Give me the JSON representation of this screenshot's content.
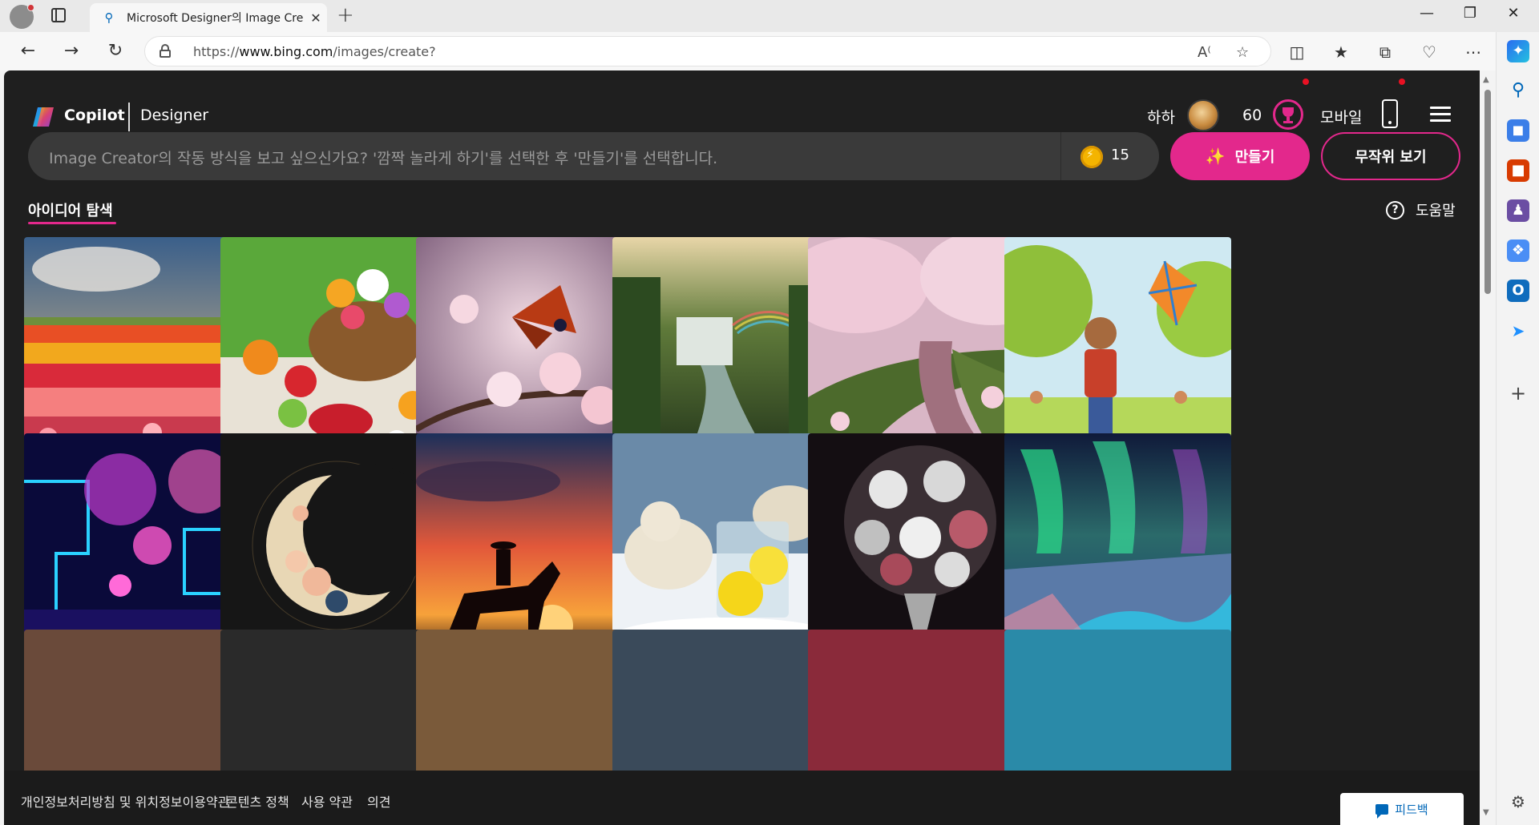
{
  "browser": {
    "tab_title": "Microsoft Designer의 Image Crea",
    "url_scheme": "https://",
    "url_host": "www.bing.com",
    "url_path": "/images/create?"
  },
  "header": {
    "brand": "Copilot",
    "product": "Designer",
    "user_name": "하하",
    "points": "60",
    "mobile_label": "모바일"
  },
  "prompt": {
    "placeholder": "Image Creator의 작동 방식을 보고 싶으신가요? '깜짝 놀라게 하기'를 선택한 후 '만들기'를 선택합니다.",
    "boost_count": "15",
    "create_label": "만들기",
    "surprise_label": "무작위 보기"
  },
  "explore": {
    "tab_label": "아이디어 탐색",
    "help_label": "도움말"
  },
  "gallery": [
    {
      "subject": "tulip-field"
    },
    {
      "subject": "picnic-flower-basket"
    },
    {
      "subject": "butterfly-cherry-blossom"
    },
    {
      "subject": "jungle-waterfall-rainbow"
    },
    {
      "subject": "cherry-blossom-river"
    },
    {
      "subject": "boy-flying-kite"
    },
    {
      "subject": "neon-circuit-garden"
    },
    {
      "subject": "floral-crescent-moon"
    },
    {
      "subject": "cowboy-sunset"
    },
    {
      "subject": "polar-bears-lemonade"
    },
    {
      "subject": "white-flower-bouquet"
    },
    {
      "subject": "aurora-landscape"
    }
  ],
  "footer": {
    "privacy": "개인정보처리방침 및 위치정보이용약관",
    "content_policy": "콘텐츠 정책",
    "terms": "사용 약관",
    "opinion": "의견",
    "feedback": "피드백"
  },
  "colors": {
    "accent": "#e3288c",
    "page_bg": "#1f1f1f",
    "prompt_bg": "#3a3a3a"
  }
}
